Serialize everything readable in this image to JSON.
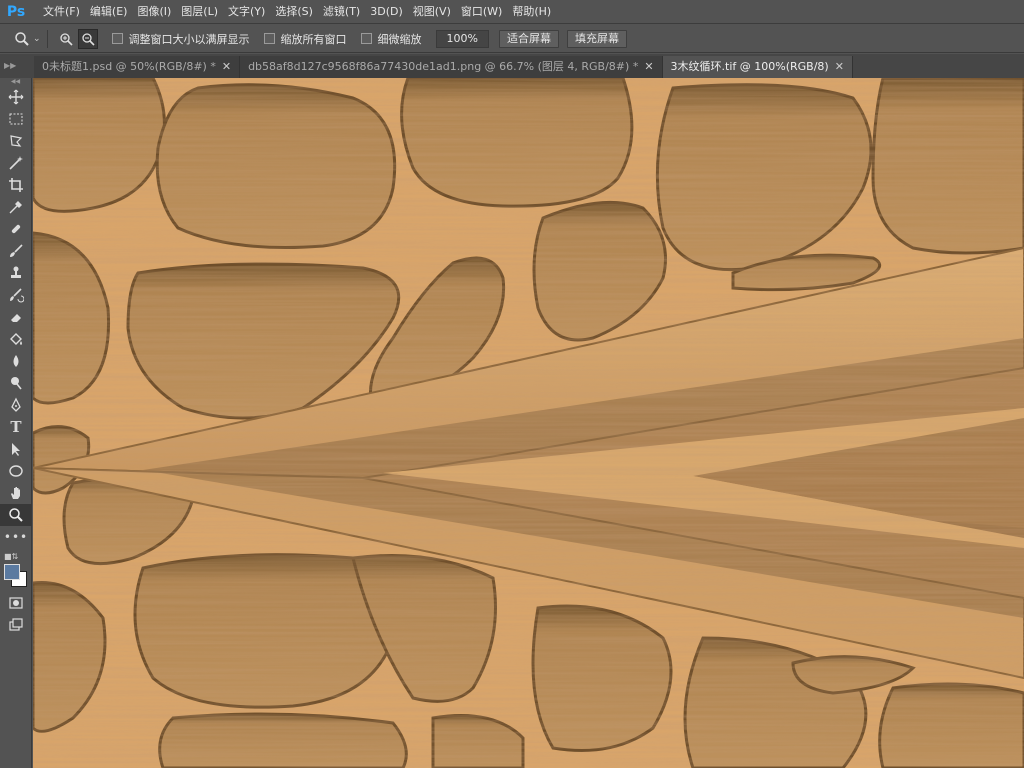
{
  "app": {
    "logo": "Ps"
  },
  "menu": [
    "文件(F)",
    "编辑(E)",
    "图像(I)",
    "图层(L)",
    "文字(Y)",
    "选择(S)",
    "滤镜(T)",
    "3D(D)",
    "视图(V)",
    "窗口(W)",
    "帮助(H)"
  ],
  "options": {
    "checkboxes": [
      "调整窗口大小以满屏显示",
      "缩放所有窗口",
      "细微缩放"
    ],
    "zoom_percent": "100%",
    "fit_screen": "适合屏幕",
    "fill_screen": "填充屏幕"
  },
  "tabs": [
    {
      "label": "0未标题1.psd @ 50%(RGB/8#) *"
    },
    {
      "label": "db58af8d127c9568f86a77430de1ad1.png @ 66.7% (图层 4, RGB/8#) *"
    },
    {
      "label": "3木纹循环.tif @ 100%(RGB/8)"
    }
  ],
  "tools": [
    "move-icon",
    "marquee-icon",
    "lasso-icon",
    "magic-wand-icon",
    "crop-icon",
    "eyedropper-icon",
    "healing-brush-icon",
    "brush-icon",
    "clone-stamp-icon",
    "history-brush-icon",
    "eraser-icon",
    "paint-bucket-icon",
    "blur-icon",
    "dodge-icon",
    "pen-icon",
    "type-icon",
    "path-selection-icon",
    "ellipse-icon",
    "hand-icon",
    "zoom-icon",
    "more-tools-icon"
  ],
  "colors": {
    "foreground": "#5b7aa0",
    "background": "#ffffff",
    "accent": "#31a8ff"
  }
}
